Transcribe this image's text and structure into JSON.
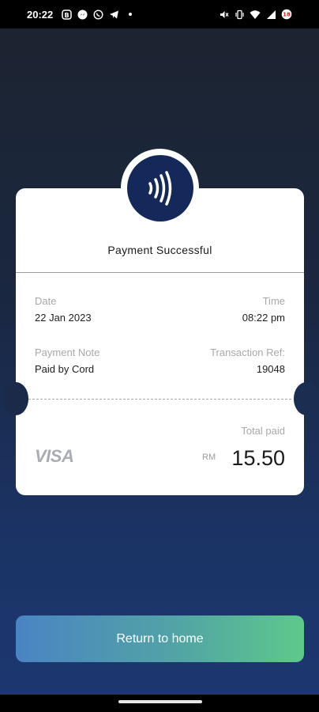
{
  "status_bar": {
    "time": "20:22",
    "icons_left": [
      "b-badge-icon",
      "messenger-icon",
      "whatsapp-icon",
      "telegram-icon"
    ],
    "icons_right": [
      "mute-icon",
      "vibrate-icon",
      "wifi-icon",
      "signal-icon",
      "battery-icon"
    ],
    "battery_level": "18"
  },
  "receipt": {
    "title": "Payment Successful",
    "date_label": "Date",
    "date_value": "22 Jan 2023",
    "time_label": "Time",
    "time_value": "08:22 pm",
    "note_label": "Payment Note",
    "note_value": "Paid by Cord",
    "ref_label": "Transaction Ref:",
    "ref_value": "19048",
    "total_label": "Total paid",
    "card_brand": "VISA",
    "currency": "RM",
    "amount": "15.50"
  },
  "cta": {
    "label": "Return to home"
  },
  "colors": {
    "badge": "#15285a",
    "cta_start": "#4a84c3",
    "cta_end": "#5dc98a",
    "bg_top": "#1c2431",
    "bg_bottom": "#1c3770"
  }
}
